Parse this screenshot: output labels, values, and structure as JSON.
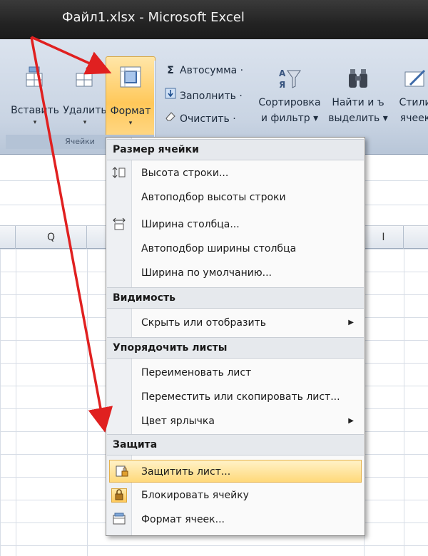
{
  "window": {
    "title": "Файл1.xlsx - Microsoft Excel"
  },
  "ribbon": {
    "cells_group": {
      "label": "Ячейки",
      "insert_label": "Вставить",
      "delete_label": "Удалить",
      "format_label": "Формат",
      "drop_glyph": "▾"
    },
    "editing_group": {
      "autosum_label": "Автосумма ·",
      "autosum_icon": "Σ",
      "fill_label": "Заполнить ·",
      "clear_label": "Очистить ·",
      "sort_label_1": "Сортировка",
      "sort_label_2": "и фильтр ▾",
      "find_label_1": "Найти и ъ",
      "find_label_2": "выделить ▾",
      "styles_label_1": "Стили",
      "styles_label_2": "ячеек"
    }
  },
  "sheet": {
    "visible_column": "Q",
    "visible_column_right": "I"
  },
  "menu": {
    "section_size": "Размер ячейки",
    "row_height": "Высота строки...",
    "autofit_row": "Автоподбор высоты строки",
    "col_width": "Ширина столбца...",
    "autofit_col": "Автоподбор ширины столбца",
    "default_width": "Ширина по умолчанию...",
    "section_visibility": "Видимость",
    "hide_show": "Скрыть или отобразить",
    "section_arrange": "Упорядочить листы",
    "rename_sheet": "Переименовать лист",
    "move_copy_sheet": "Переместить или скопировать лист...",
    "tab_color": "Цвет ярлычка",
    "section_protect": "Защита",
    "protect_sheet": "Защитить лист...",
    "lock_cell": "Блокировать ячейку",
    "format_cells": "Формат ячеек...",
    "submenu_arrow": "▶"
  },
  "colors": {
    "arrow": "#e02020",
    "highlight": "#ffd97a",
    "ribbon": "#c9d4e3"
  },
  "icons": {
    "row_height": "row-height-icon",
    "col_width": "column-width-icon",
    "protect": "protect-sheet-icon",
    "lock": "lock-icon",
    "format_cells": "format-cells-icon"
  }
}
